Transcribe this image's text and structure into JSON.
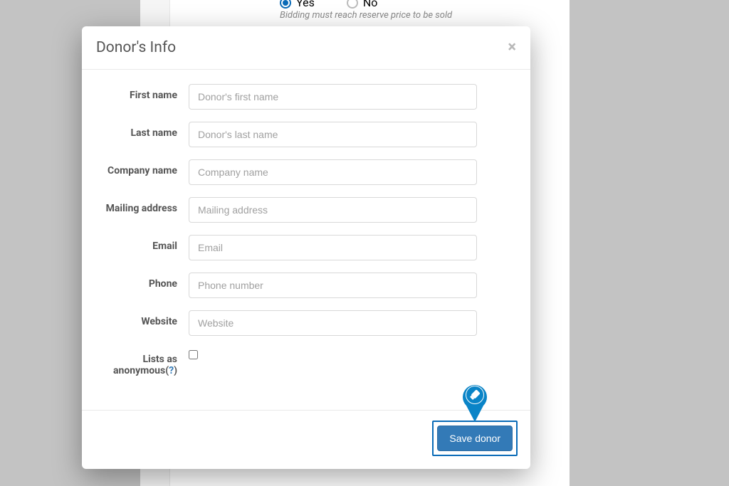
{
  "background": {
    "hint": "Bidding must reach reserve price to be sold",
    "radio_yes": "Yes",
    "radio_no": "No"
  },
  "modal": {
    "title": "Donor's Info",
    "fields": {
      "first_name": {
        "label": "First name",
        "placeholder": "Donor's first name"
      },
      "last_name": {
        "label": "Last name",
        "placeholder": "Donor's last name"
      },
      "company": {
        "label": "Company name",
        "placeholder": "Company name"
      },
      "mailing": {
        "label": "Mailing address",
        "placeholder": "Mailing address"
      },
      "email": {
        "label": "Email",
        "placeholder": "Email"
      },
      "phone": {
        "label": "Phone",
        "placeholder": "Phone number"
      },
      "website": {
        "label": "Website",
        "placeholder": "Website"
      },
      "anonymous": {
        "label_part1": "Lists as anonymous(",
        "help": "?",
        "label_part2": ")"
      }
    },
    "save_button": "Save donor"
  }
}
